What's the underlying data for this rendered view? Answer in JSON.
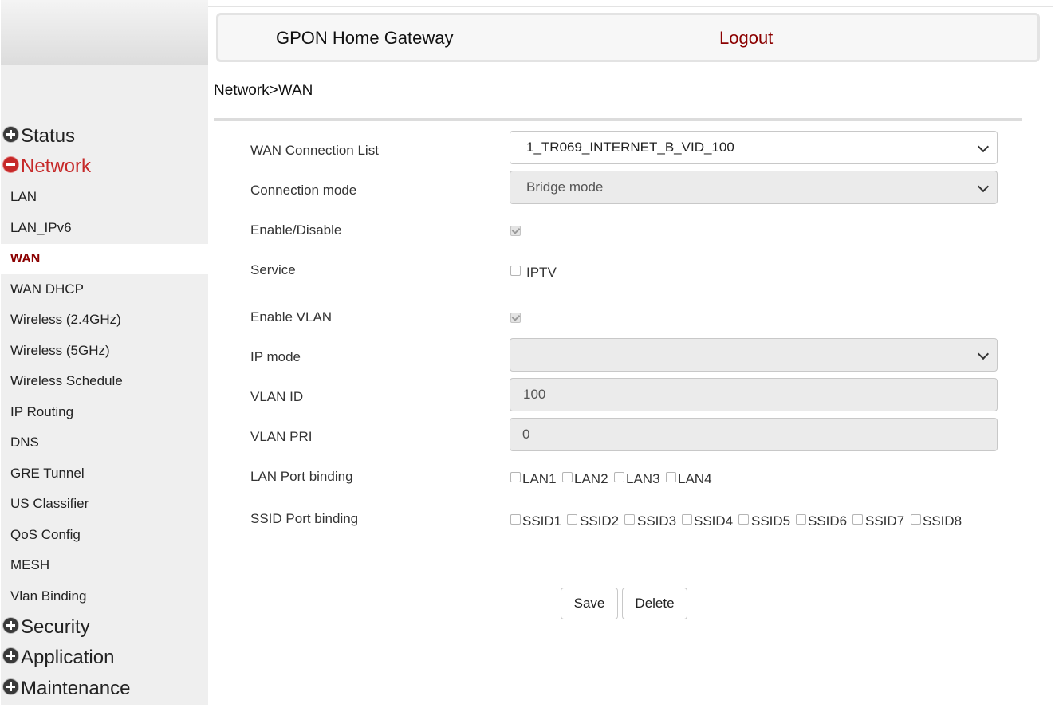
{
  "header": {
    "title": "GPON Home Gateway",
    "logout": "Logout"
  },
  "breadcrumb": "Network>WAN",
  "sidebar": {
    "sections": {
      "status": "Status",
      "network": "Network",
      "security": "Security",
      "application": "Application",
      "maintenance": "Maintenance"
    },
    "network_items": [
      "LAN",
      "LAN_IPv6",
      "WAN",
      "WAN DHCP",
      "Wireless (2.4GHz)",
      "Wireless (5GHz)",
      "Wireless Schedule",
      "IP Routing",
      "DNS",
      "GRE Tunnel",
      "US Classifier",
      "QoS Config",
      "MESH",
      "Vlan Binding"
    ],
    "active_item": "WAN"
  },
  "form": {
    "wan_connection_list": {
      "label": "WAN Connection List",
      "value": "1_TR069_INTERNET_B_VID_100"
    },
    "connection_mode": {
      "label": "Connection mode",
      "value": "Bridge mode"
    },
    "enable_disable": {
      "label": "Enable/Disable",
      "checked": true
    },
    "service": {
      "label": "Service",
      "option": "IPTV",
      "checked": false
    },
    "enable_vlan": {
      "label": "Enable VLAN",
      "checked": true
    },
    "ip_mode": {
      "label": "IP mode",
      "value": ""
    },
    "vlan_id": {
      "label": "VLAN ID",
      "value": "100"
    },
    "vlan_pri": {
      "label": "VLAN PRI",
      "value": "0"
    },
    "lan_port_binding": {
      "label": "LAN Port binding",
      "ports": [
        "LAN1",
        "LAN2",
        "LAN3",
        "LAN4"
      ]
    },
    "ssid_port_binding": {
      "label": "SSID Port binding",
      "ports": [
        "SSID1",
        "SSID2",
        "SSID3",
        "SSID4",
        "SSID5",
        "SSID6",
        "SSID7",
        "SSID8"
      ]
    }
  },
  "buttons": {
    "save": "Save",
    "delete": "Delete"
  }
}
